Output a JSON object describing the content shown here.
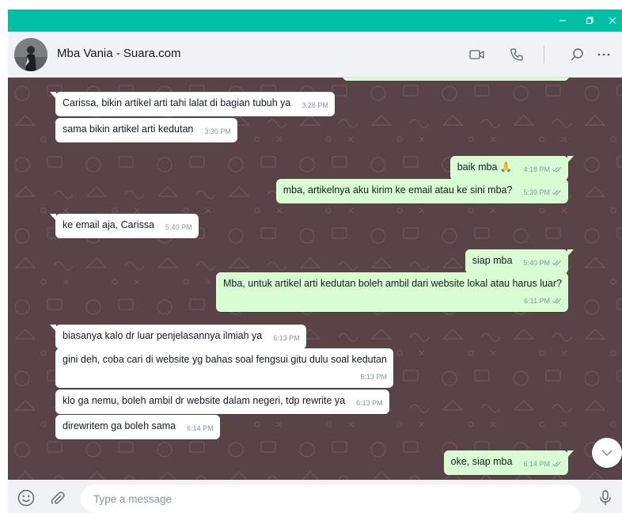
{
  "window": {
    "accent_color": "#00bfa5",
    "controls": {
      "minimize_icon": "minimize-icon",
      "maximize_icon": "restore-icon",
      "close_icon": "close-icon"
    }
  },
  "header": {
    "contact_name": "Mba Vania - Suara.com",
    "icons": [
      "video-call-icon",
      "voice-call-icon",
      "search-icon",
      "more-options-icon"
    ]
  },
  "messages": [
    {
      "direction": "in",
      "text": "Carissa, bikin artikel arti tahi lalat di bagian tubuh ya",
      "time": "3:28 PM"
    },
    {
      "direction": "in",
      "text": "sama bikin artikel arti kedutan",
      "time": "3:30 PM"
    },
    {
      "direction": "out",
      "text": "baik mba 🙏",
      "time": "4:18 PM",
      "status": "read"
    },
    {
      "direction": "out",
      "text": "mba, artikelnya aku kirim ke email atau ke sini mba?",
      "time": "5:39 PM",
      "status": "read"
    },
    {
      "direction": "in",
      "text": "ke email aja, Carissa",
      "time": "5:40 PM"
    },
    {
      "direction": "out",
      "text": "siap mba",
      "time": "5:40 PM",
      "status": "read"
    },
    {
      "direction": "out",
      "text": "Mba, untuk artikel arti kedutan boleh ambil dari website lokal atau harus luar?",
      "time": "6:11 PM",
      "status": "read"
    },
    {
      "direction": "in",
      "text": "biasanya kalo dr luar penjelasannya ilmiah ya",
      "time": "6:13 PM"
    },
    {
      "direction": "in",
      "text": "gini deh, coba cari di website yg bahas soal fengsui gitu dulu soal kedutan",
      "time": "6:13 PM"
    },
    {
      "direction": "in",
      "text": "klo ga nemu, boleh ambil dr website dalam negeri, tdp rewrite ya",
      "time": "6:13 PM"
    },
    {
      "direction": "in",
      "text": "direwritem ga boleh sama",
      "time": "6:14 PM"
    },
    {
      "direction": "out",
      "text": "oke, siap mba",
      "time": "6:14 PM",
      "status": "read"
    }
  ],
  "composer": {
    "placeholder": "Type a message",
    "icons": [
      "emoji-icon",
      "attach-icon",
      "microphone-icon"
    ]
  },
  "colors": {
    "chat_background": "#5a4346",
    "incoming_bubble": "#ffffff",
    "outgoing_bubble": "#d9fdd3",
    "read_tick": "#8696a0"
  }
}
